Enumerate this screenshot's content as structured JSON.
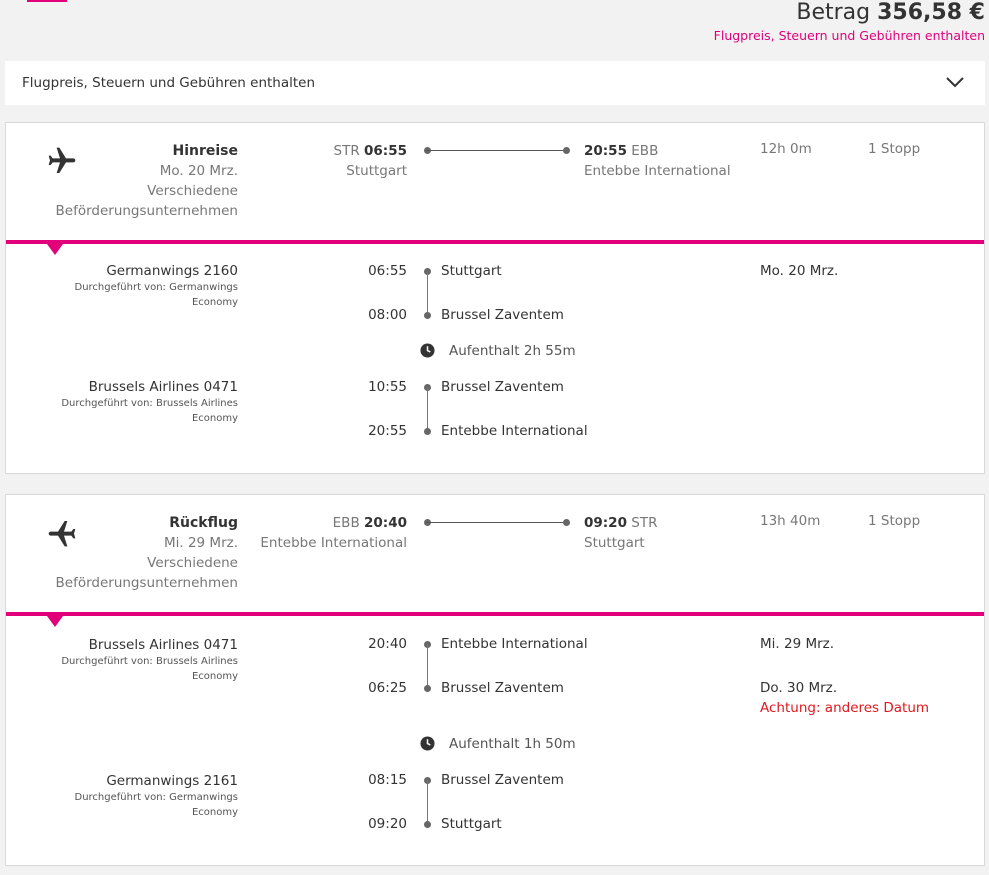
{
  "summary": {
    "total_label": "Betrag",
    "total_amount": "356,58 €",
    "total_note": "Flugpreis, Steuern und Gebühren enthalten"
  },
  "price_bar": {
    "label": "Flugpreis, Steuern und Gebühren enthalten",
    "icon": "chevron-down-icon"
  },
  "outbound": {
    "direction": "Hinreise",
    "date": "Mo. 20 Mrz.",
    "carrier_line1": "Verschiedene",
    "carrier_line2": "Beförderungsunternehmen",
    "dep_code": "STR",
    "dep_time": "06:55",
    "dep_city": "Stuttgart",
    "arr_time": "20:55",
    "arr_code": "EBB",
    "arr_city": "Entebbe International",
    "duration": "12h 0m",
    "stops": "1 Stopp",
    "segments": [
      {
        "flight": "Germanwings 2160",
        "operated": "Durchgeführt von: Germanwings",
        "cabin": "Economy",
        "dep_time": "06:55",
        "dep_place": "Stuttgart",
        "arr_time": "08:00",
        "arr_place": "Brussel Zaventem",
        "date": "Mo. 20 Mrz."
      },
      {
        "flight": "Brussels Airlines 0471",
        "operated": "Durchgeführt von: Brussels Airlines",
        "cabin": "Economy",
        "dep_time": "10:55",
        "dep_place": "Brussel Zaventem",
        "arr_time": "20:55",
        "arr_place": "Entebbe International"
      }
    ],
    "layover": "Aufenthalt 2h 55m"
  },
  "return": {
    "direction": "Rückflug",
    "date": "Mi. 29 Mrz.",
    "carrier_line1": "Verschiedene",
    "carrier_line2": "Beförderungsunternehmen",
    "dep_code": "EBB",
    "dep_time": "20:40",
    "dep_city": "Entebbe International",
    "arr_time": "09:20",
    "arr_code": "STR",
    "arr_city": "Stuttgart",
    "duration": "13h 40m",
    "stops": "1 Stopp",
    "segments": [
      {
        "flight": "Brussels Airlines 0471",
        "operated": "Durchgeführt von: Brussels Airlines",
        "cabin": "Economy",
        "dep_time": "20:40",
        "dep_place": "Entebbe International",
        "arr_time": "06:25",
        "arr_place": "Brussel Zaventem",
        "date": "Mi. 29 Mrz.",
        "arr_date": "Do. 30 Mrz.",
        "warning": "Achtung: anderes Datum"
      },
      {
        "flight": "Germanwings 2161",
        "operated": "Durchgeführt von: Germanwings",
        "cabin": "Economy",
        "dep_time": "08:15",
        "dep_place": "Brussel Zaventem",
        "arr_time": "09:20",
        "arr_place": "Stuttgart"
      }
    ],
    "layover": "Aufenthalt 1h 50m"
  },
  "colors": {
    "accent": "#e2007a",
    "warning": "#e0181e",
    "background": "#f2f2f2"
  }
}
